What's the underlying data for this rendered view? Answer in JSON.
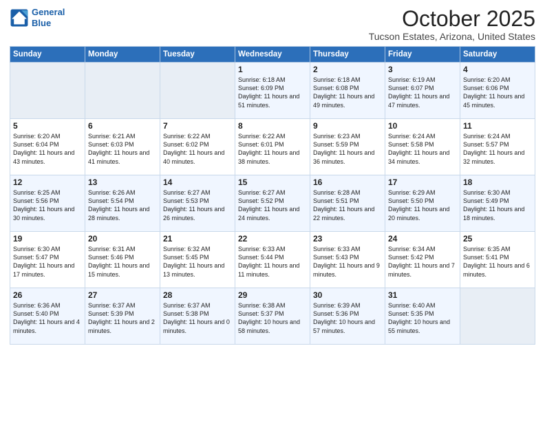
{
  "header": {
    "logo_line1": "General",
    "logo_line2": "Blue",
    "month": "October 2025",
    "location": "Tucson Estates, Arizona, United States"
  },
  "weekdays": [
    "Sunday",
    "Monday",
    "Tuesday",
    "Wednesday",
    "Thursday",
    "Friday",
    "Saturday"
  ],
  "weeks": [
    [
      {
        "day": "",
        "sunrise": "",
        "sunset": "",
        "daylight": ""
      },
      {
        "day": "",
        "sunrise": "",
        "sunset": "",
        "daylight": ""
      },
      {
        "day": "",
        "sunrise": "",
        "sunset": "",
        "daylight": ""
      },
      {
        "day": "1",
        "sunrise": "Sunrise: 6:18 AM",
        "sunset": "Sunset: 6:09 PM",
        "daylight": "Daylight: 11 hours and 51 minutes."
      },
      {
        "day": "2",
        "sunrise": "Sunrise: 6:18 AM",
        "sunset": "Sunset: 6:08 PM",
        "daylight": "Daylight: 11 hours and 49 minutes."
      },
      {
        "day": "3",
        "sunrise": "Sunrise: 6:19 AM",
        "sunset": "Sunset: 6:07 PM",
        "daylight": "Daylight: 11 hours and 47 minutes."
      },
      {
        "day": "4",
        "sunrise": "Sunrise: 6:20 AM",
        "sunset": "Sunset: 6:06 PM",
        "daylight": "Daylight: 11 hours and 45 minutes."
      }
    ],
    [
      {
        "day": "5",
        "sunrise": "Sunrise: 6:20 AM",
        "sunset": "Sunset: 6:04 PM",
        "daylight": "Daylight: 11 hours and 43 minutes."
      },
      {
        "day": "6",
        "sunrise": "Sunrise: 6:21 AM",
        "sunset": "Sunset: 6:03 PM",
        "daylight": "Daylight: 11 hours and 41 minutes."
      },
      {
        "day": "7",
        "sunrise": "Sunrise: 6:22 AM",
        "sunset": "Sunset: 6:02 PM",
        "daylight": "Daylight: 11 hours and 40 minutes."
      },
      {
        "day": "8",
        "sunrise": "Sunrise: 6:22 AM",
        "sunset": "Sunset: 6:01 PM",
        "daylight": "Daylight: 11 hours and 38 minutes."
      },
      {
        "day": "9",
        "sunrise": "Sunrise: 6:23 AM",
        "sunset": "Sunset: 5:59 PM",
        "daylight": "Daylight: 11 hours and 36 minutes."
      },
      {
        "day": "10",
        "sunrise": "Sunrise: 6:24 AM",
        "sunset": "Sunset: 5:58 PM",
        "daylight": "Daylight: 11 hours and 34 minutes."
      },
      {
        "day": "11",
        "sunrise": "Sunrise: 6:24 AM",
        "sunset": "Sunset: 5:57 PM",
        "daylight": "Daylight: 11 hours and 32 minutes."
      }
    ],
    [
      {
        "day": "12",
        "sunrise": "Sunrise: 6:25 AM",
        "sunset": "Sunset: 5:56 PM",
        "daylight": "Daylight: 11 hours and 30 minutes."
      },
      {
        "day": "13",
        "sunrise": "Sunrise: 6:26 AM",
        "sunset": "Sunset: 5:54 PM",
        "daylight": "Daylight: 11 hours and 28 minutes."
      },
      {
        "day": "14",
        "sunrise": "Sunrise: 6:27 AM",
        "sunset": "Sunset: 5:53 PM",
        "daylight": "Daylight: 11 hours and 26 minutes."
      },
      {
        "day": "15",
        "sunrise": "Sunrise: 6:27 AM",
        "sunset": "Sunset: 5:52 PM",
        "daylight": "Daylight: 11 hours and 24 minutes."
      },
      {
        "day": "16",
        "sunrise": "Sunrise: 6:28 AM",
        "sunset": "Sunset: 5:51 PM",
        "daylight": "Daylight: 11 hours and 22 minutes."
      },
      {
        "day": "17",
        "sunrise": "Sunrise: 6:29 AM",
        "sunset": "Sunset: 5:50 PM",
        "daylight": "Daylight: 11 hours and 20 minutes."
      },
      {
        "day": "18",
        "sunrise": "Sunrise: 6:30 AM",
        "sunset": "Sunset: 5:49 PM",
        "daylight": "Daylight: 11 hours and 18 minutes."
      }
    ],
    [
      {
        "day": "19",
        "sunrise": "Sunrise: 6:30 AM",
        "sunset": "Sunset: 5:47 PM",
        "daylight": "Daylight: 11 hours and 17 minutes."
      },
      {
        "day": "20",
        "sunrise": "Sunrise: 6:31 AM",
        "sunset": "Sunset: 5:46 PM",
        "daylight": "Daylight: 11 hours and 15 minutes."
      },
      {
        "day": "21",
        "sunrise": "Sunrise: 6:32 AM",
        "sunset": "Sunset: 5:45 PM",
        "daylight": "Daylight: 11 hours and 13 minutes."
      },
      {
        "day": "22",
        "sunrise": "Sunrise: 6:33 AM",
        "sunset": "Sunset: 5:44 PM",
        "daylight": "Daylight: 11 hours and 11 minutes."
      },
      {
        "day": "23",
        "sunrise": "Sunrise: 6:33 AM",
        "sunset": "Sunset: 5:43 PM",
        "daylight": "Daylight: 11 hours and 9 minutes."
      },
      {
        "day": "24",
        "sunrise": "Sunrise: 6:34 AM",
        "sunset": "Sunset: 5:42 PM",
        "daylight": "Daylight: 11 hours and 7 minutes."
      },
      {
        "day": "25",
        "sunrise": "Sunrise: 6:35 AM",
        "sunset": "Sunset: 5:41 PM",
        "daylight": "Daylight: 11 hours and 6 minutes."
      }
    ],
    [
      {
        "day": "26",
        "sunrise": "Sunrise: 6:36 AM",
        "sunset": "Sunset: 5:40 PM",
        "daylight": "Daylight: 11 hours and 4 minutes."
      },
      {
        "day": "27",
        "sunrise": "Sunrise: 6:37 AM",
        "sunset": "Sunset: 5:39 PM",
        "daylight": "Daylight: 11 hours and 2 minutes."
      },
      {
        "day": "28",
        "sunrise": "Sunrise: 6:37 AM",
        "sunset": "Sunset: 5:38 PM",
        "daylight": "Daylight: 11 hours and 0 minutes."
      },
      {
        "day": "29",
        "sunrise": "Sunrise: 6:38 AM",
        "sunset": "Sunset: 5:37 PM",
        "daylight": "Daylight: 10 hours and 58 minutes."
      },
      {
        "day": "30",
        "sunrise": "Sunrise: 6:39 AM",
        "sunset": "Sunset: 5:36 PM",
        "daylight": "Daylight: 10 hours and 57 minutes."
      },
      {
        "day": "31",
        "sunrise": "Sunrise: 6:40 AM",
        "sunset": "Sunset: 5:35 PM",
        "daylight": "Daylight: 10 hours and 55 minutes."
      },
      {
        "day": "",
        "sunrise": "",
        "sunset": "",
        "daylight": ""
      }
    ]
  ]
}
